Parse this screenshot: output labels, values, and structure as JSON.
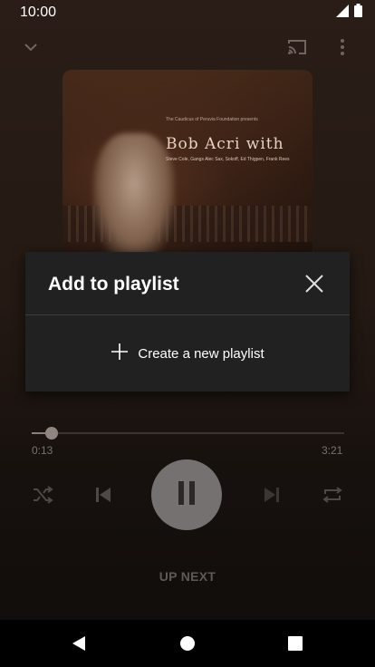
{
  "status_bar": {
    "time": "10:00",
    "icons": [
      "signal-icon",
      "battery-icon"
    ]
  },
  "top_bar": {
    "icons": [
      "chevron-down-icon",
      "cast-icon",
      "more-vert-icon"
    ]
  },
  "album": {
    "small_text": "The Caudicus of Peruvia Foundation presents",
    "title": "Bob Acri with",
    "credits": "Steve Cole, Gangs Alec Sax, Sokoff, Ed Thigpen, Frank Rees"
  },
  "dialog": {
    "title": "Add to playlist",
    "create_label": "Create a new playlist",
    "icons": [
      "close-icon",
      "plus-icon"
    ]
  },
  "player": {
    "elapsed": "0:13",
    "duration": "3:21",
    "progress_fraction": 0.0647,
    "controls": [
      "shuffle-icon",
      "previous-icon",
      "pause-icon",
      "next-icon",
      "repeat-icon"
    ]
  },
  "up_next": {
    "label": "UP NEXT"
  },
  "nav_bar": {
    "icons": [
      "back-icon",
      "home-icon",
      "recents-icon"
    ]
  },
  "colors": {
    "background": "#1b1411",
    "dialog": "#212121",
    "play_button": "#747170"
  }
}
